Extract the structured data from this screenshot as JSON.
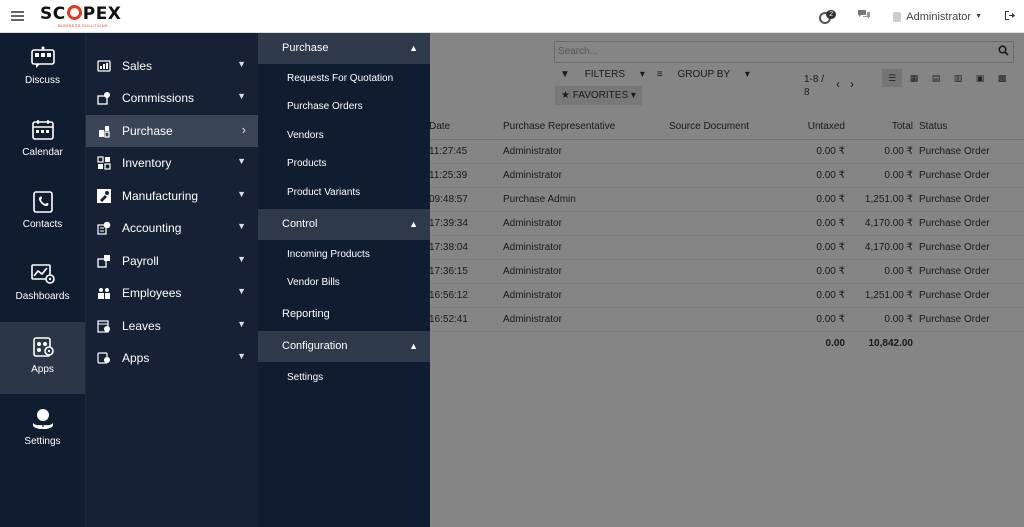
{
  "topbar": {
    "logo": "SCOPEX",
    "logo_subtitle": "BUSINESS SOLUTIONS",
    "activity_count": "2",
    "user_name": "Administrator"
  },
  "rail": {
    "items": [
      {
        "label": "Discuss",
        "icon": "discuss-icon"
      },
      {
        "label": "Calendar",
        "icon": "calendar-icon"
      },
      {
        "label": "Contacts",
        "icon": "contacts-icon"
      },
      {
        "label": "Dashboards",
        "icon": "dashboards-icon"
      },
      {
        "label": "Apps",
        "icon": "apps-icon",
        "active": true
      },
      {
        "label": "Settings",
        "icon": "settings-icon"
      }
    ]
  },
  "apps_menu": {
    "items": [
      {
        "label": "Sales"
      },
      {
        "label": "Commissions"
      },
      {
        "label": "Purchase",
        "active": true
      },
      {
        "label": "Inventory"
      },
      {
        "label": "Manufacturing"
      },
      {
        "label": "Accounting"
      },
      {
        "label": "Payroll"
      },
      {
        "label": "Employees"
      },
      {
        "label": "Leaves"
      },
      {
        "label": "Apps"
      }
    ]
  },
  "purchase_menu": {
    "purchase_header": "Purchase",
    "purchase_items": [
      "Requests For Quotation",
      "Purchase Orders",
      "Vendors",
      "Products",
      "Product Variants"
    ],
    "control_header": "Control",
    "control_items": [
      "Incoming Products",
      "Vendor Bills"
    ],
    "reporting": "Reporting",
    "configuration_header": "Configuration",
    "configuration_items": [
      "Settings"
    ]
  },
  "search": {
    "placeholder": "Search...",
    "filters_label": "FILTERS",
    "group_by_label": "GROUP BY",
    "favorites_label": "FAVORITES",
    "pager_line1": "1-8 /",
    "pager_line2": "8"
  },
  "table": {
    "headers": [
      "Date",
      "Purchase Representative",
      "Source Document",
      "Untaxed",
      "Total",
      "Status"
    ],
    "rows": [
      {
        "date": "11:27:45",
        "rep": "Administrator",
        "source": "",
        "untaxed": "0.00 ₹",
        "total": "0.00 ₹",
        "status": "Purchase Order"
      },
      {
        "date": "11:25:39",
        "rep": "Administrator",
        "source": "",
        "untaxed": "0.00 ₹",
        "total": "0.00 ₹",
        "status": "Purchase Order"
      },
      {
        "date": "09:48:57",
        "rep": "Purchase Admin",
        "source": "",
        "untaxed": "0.00 ₹",
        "total": "1,251.00 ₹",
        "status": "Purchase Order"
      },
      {
        "date": "17:39:34",
        "rep": "Administrator",
        "source": "",
        "untaxed": "0.00 ₹",
        "total": "4,170.00 ₹",
        "status": "Purchase Order"
      },
      {
        "date": "17:38:04",
        "rep": "Administrator",
        "source": "",
        "untaxed": "0.00 ₹",
        "total": "4,170.00 ₹",
        "status": "Purchase Order"
      },
      {
        "date": "17:36:15",
        "rep": "Administrator",
        "source": "",
        "untaxed": "0.00 ₹",
        "total": "0.00 ₹",
        "status": "Purchase Order"
      },
      {
        "date": "16:56:12",
        "rep": "Administrator",
        "source": "",
        "untaxed": "0.00 ₹",
        "total": "1,251.00 ₹",
        "status": "Purchase Order"
      },
      {
        "date": "16:52:41",
        "rep": "Administrator",
        "source": "",
        "untaxed": "0.00 ₹",
        "total": "0.00 ₹",
        "status": "Purchase Order"
      }
    ],
    "total_untaxed": "0.00",
    "total_total": "10,842.00"
  }
}
